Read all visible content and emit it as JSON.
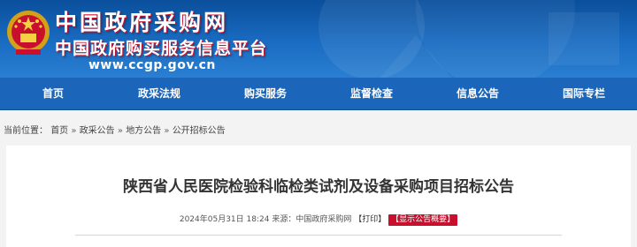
{
  "header": {
    "site_title": "中国政府采购网",
    "site_subtitle": "中国政府购买服务信息平台",
    "site_url": "www.ccgp.gov.cn",
    "emblem_icon": "national-emblem-icon"
  },
  "nav": {
    "items": [
      {
        "label": "首页"
      },
      {
        "label": "政采法规"
      },
      {
        "label": "购买服务"
      },
      {
        "label": "监督检查"
      },
      {
        "label": "信息公告"
      },
      {
        "label": "国际专栏"
      }
    ]
  },
  "breadcrumb": {
    "prefix": "当前位置：",
    "items": [
      "首页",
      "政采公告",
      "地方公告",
      "公开招标公告"
    ],
    "separator": "»"
  },
  "article": {
    "title": "陕西省人民医院检验科临检类试剂及设备采购项目招标公告",
    "datetime": "2024年05月31日 18:24",
    "source_label": "来源：",
    "source": "中国政府采购网",
    "print_label": "【打印】",
    "summary_button": "【显示公告概要】"
  },
  "colors": {
    "banner": "#1a6cc2",
    "nav": "#1b65ba",
    "accent_red": "#c8102e"
  }
}
